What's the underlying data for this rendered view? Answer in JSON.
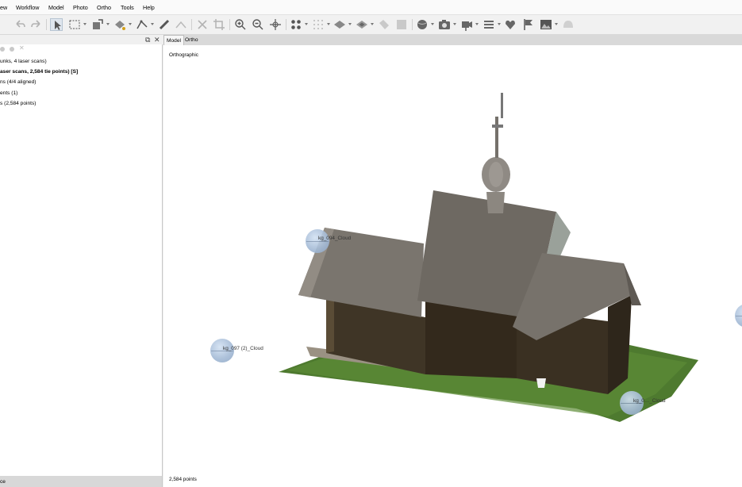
{
  "menu": [
    "ew",
    "Workflow",
    "Model",
    "Photo",
    "Ortho",
    "Tools",
    "Help"
  ],
  "toolbar": {
    "icons": [
      "undo-icon",
      "redo-icon",
      "navigation-arrow-icon",
      "rectangle-selection-icon",
      "resize-region-icon",
      "draw-polygon-icon",
      "draw-polyline-icon",
      "ruler-icon",
      "delete-icon",
      "crop-icon",
      "zoom-in-icon",
      "zoom-out-icon",
      "move-object-icon",
      "point-cloud-view-icon",
      "dense-cloud-view-icon",
      "solid-model-icon",
      "textured-model-icon",
      "tiled-model-icon",
      "dem-icon",
      "globe-icon",
      "camera-icon",
      "animation-icon",
      "list-icon",
      "markers-icon",
      "flag-icon",
      "image-icon",
      "mask-icon"
    ]
  },
  "workspace": {
    "tree": [
      "unks, 4 laser scans)",
      "aser scans, 2,584 tie points) [S]",
      "ns (4/4 aligned)",
      "ents (1)",
      "s (2,584 points)"
    ],
    "footer_label": "ce"
  },
  "view_tabs": [
    "Model",
    "Ortho"
  ],
  "viewport": {
    "projection_label": "Orthographic",
    "point_count": "2,584 points",
    "cameras": [
      {
        "label": "kg_094_Cloud"
      },
      {
        "label": "kg_097 (2)_Cloud"
      },
      {
        "label": "kg_0…_Cloud"
      },
      {
        "label": ""
      }
    ]
  },
  "colors": {
    "roof": "#7a756e",
    "log_walls": "#3f3526",
    "grass": "#4e7a2f",
    "camera_sphere": "#a6bcd7",
    "selection_highlight": "#dfe6ee"
  }
}
